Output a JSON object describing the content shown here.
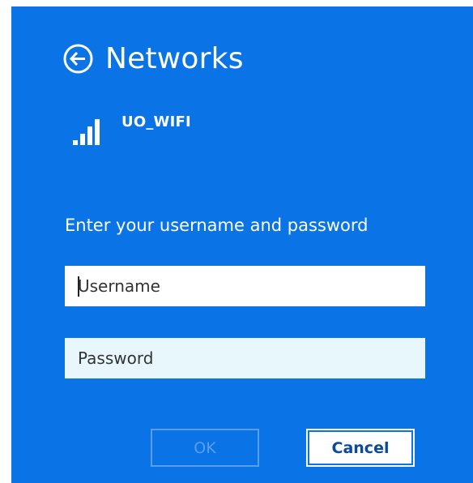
{
  "header": {
    "title": "Networks",
    "back_icon": "back-arrow-circle-icon"
  },
  "network": {
    "name": "UO_WIFI",
    "signal_icon": "wifi-signal-bars-icon",
    "signal_bars": 4
  },
  "login": {
    "prompt": "Enter your username and password",
    "username": {
      "placeholder": "Username",
      "value": ""
    },
    "password": {
      "placeholder": "Password",
      "value": ""
    }
  },
  "buttons": {
    "ok_label": "OK",
    "ok_enabled": false,
    "cancel_label": "Cancel"
  },
  "colors": {
    "panel_background": "#0a74e6",
    "text": "#ffffff",
    "password_field_background": "#e8f7fb",
    "ok_disabled": "#5a9ee8",
    "cancel_text": "#0a4a9a"
  }
}
